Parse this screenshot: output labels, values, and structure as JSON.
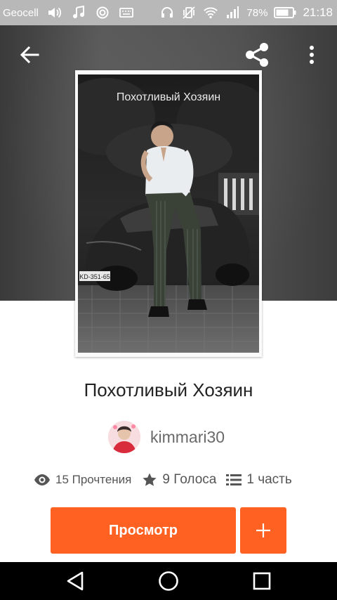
{
  "status_bar": {
    "carrier": "Geocell",
    "battery": "78%",
    "time": "21:18",
    "left_icons": [
      "volume-icon",
      "music-icon",
      "sync-icon",
      "keyboard-icon"
    ],
    "right_icons": [
      "headset-icon",
      "vibrate-icon",
      "wifi-icon",
      "signal-icon",
      "battery-icon"
    ]
  },
  "header": {
    "back_icon": "arrow-left-icon",
    "share_icon": "share-icon",
    "more_icon": "more-vertical-icon"
  },
  "cover": {
    "title": "Похотливый Хозяин",
    "plate": "KD-351-65"
  },
  "story": {
    "title": "Похотливый Хозяин",
    "author": "kimmari30"
  },
  "stats": {
    "reads": "15 Прочтения",
    "votes": "9 Голоса",
    "parts": "1 часть"
  },
  "actions": {
    "read_label": "Просмотр",
    "add_icon": "plus-icon"
  },
  "colors": {
    "accent": "#ff6122",
    "status_bar": "#b8b8b8",
    "nav_bar": "#000000"
  },
  "nav": [
    "back-triangle-icon",
    "home-circle-icon",
    "recents-square-icon"
  ]
}
